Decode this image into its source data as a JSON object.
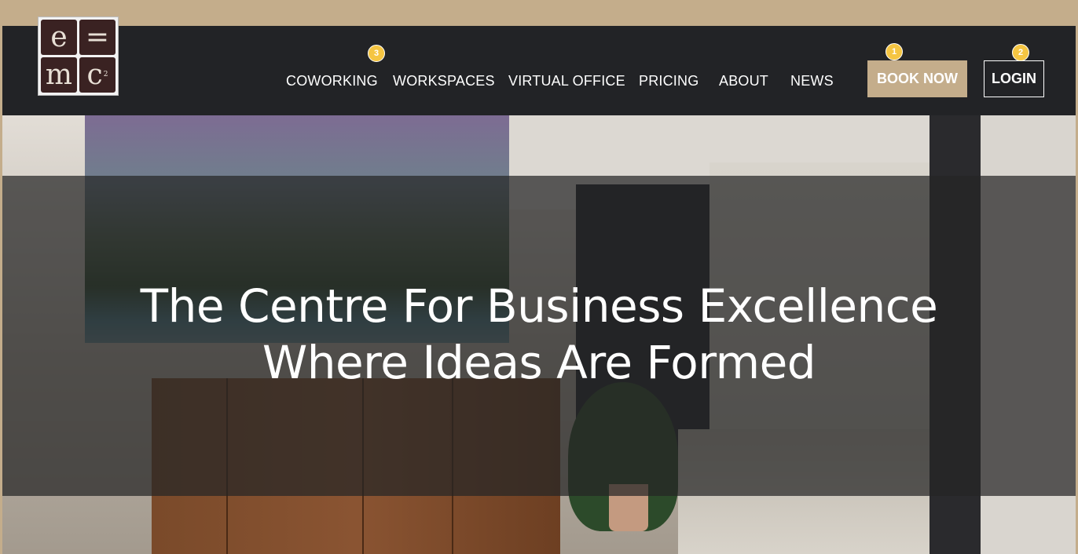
{
  "logo": {
    "cells": [
      "e",
      "=",
      "m",
      "c"
    ],
    "superscript": "2"
  },
  "nav": {
    "items": [
      {
        "label": "COWORKING",
        "badge": "3"
      },
      {
        "label": "WORKSPACES"
      },
      {
        "label": "VIRTUAL OFFICE"
      },
      {
        "label": "PRICING"
      },
      {
        "label": "ABOUT"
      },
      {
        "label": "NEWS"
      }
    ],
    "book_now": {
      "label": "BOOK NOW",
      "badge": "1"
    },
    "login": {
      "label": "LOGIN",
      "badge": "2"
    }
  },
  "hero": {
    "line1": "The Centre For Business Excellence",
    "line2": "Where Ideas Are Formed"
  },
  "colors": {
    "accent": "#c4ad8b",
    "header_bg": "#222326",
    "badge": "#f5c542"
  }
}
